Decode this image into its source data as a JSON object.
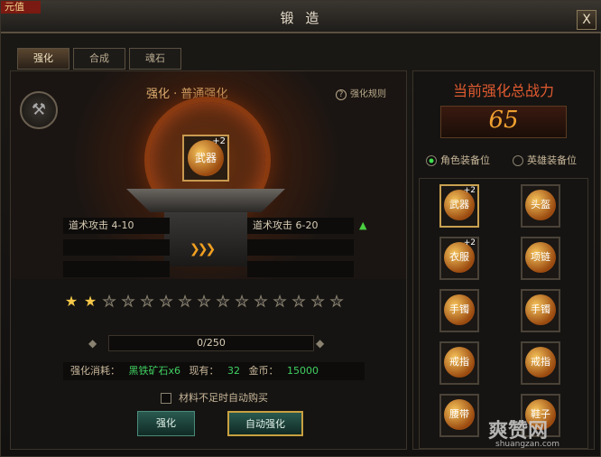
{
  "window": {
    "corner_badge": "元值",
    "title": "锻 造",
    "close_label": "X"
  },
  "tabs": [
    {
      "label": "强化"
    },
    {
      "label": "合成"
    },
    {
      "label": "魂石"
    }
  ],
  "forge": {
    "title": "强化 · 普通强化",
    "help": "强化规则",
    "item": {
      "name": "武器",
      "level": "+2"
    },
    "current_stat": "道术攻击 4-10",
    "next_stat": "道术攻击 6-20"
  },
  "stars": {
    "filled": 2,
    "total": 15
  },
  "progress": {
    "text": "0/250"
  },
  "materials": {
    "label": "强化消耗：",
    "item": "黑铁矿石x6",
    "owned_label": "现有：",
    "owned": "32",
    "gold_label": "金币：",
    "gold": "15000"
  },
  "auto_buy": {
    "label": "材料不足时自动购买"
  },
  "buttons": {
    "enhance": "强化",
    "auto": "自动强化"
  },
  "power": {
    "title": "当前强化总战力",
    "value": "65"
  },
  "positions": {
    "role": "角色装备位",
    "hero": "英雄装备位"
  },
  "equipment": [
    {
      "name": "武器",
      "plus": "+2"
    },
    {
      "name": "头盔",
      "plus": ""
    },
    {
      "name": "衣服",
      "plus": "+2"
    },
    {
      "name": "项链",
      "plus": ""
    },
    {
      "name": "手镯",
      "plus": ""
    },
    {
      "name": "手镯",
      "plus": ""
    },
    {
      "name": "戒指",
      "plus": ""
    },
    {
      "name": "戒指",
      "plus": ""
    },
    {
      "name": "腰带",
      "plus": ""
    },
    {
      "name": "鞋子",
      "plus": ""
    }
  ],
  "watermark": {
    "logo": "爽赞网",
    "url": "shuangzan.com"
  }
}
